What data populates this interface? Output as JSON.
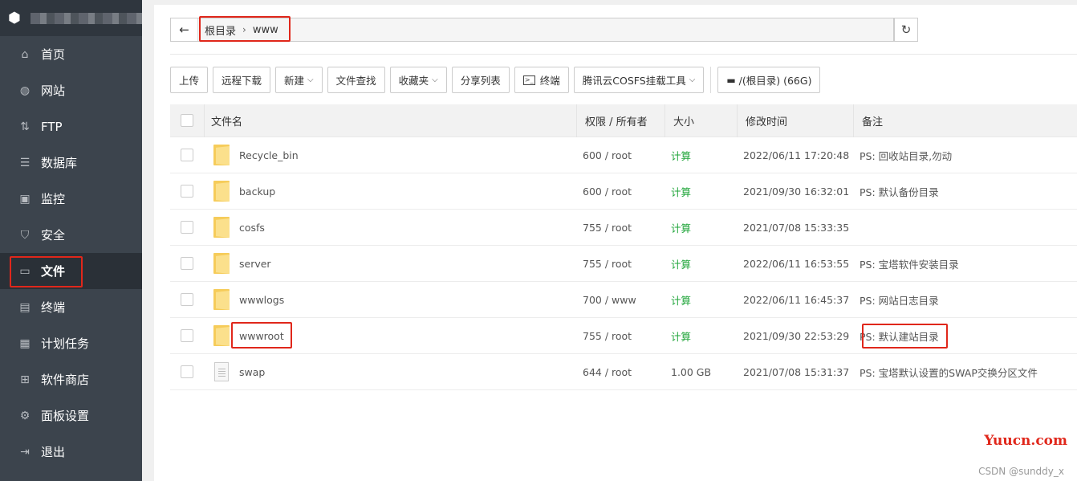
{
  "sidebar": {
    "items": [
      {
        "label": "首页",
        "icon": "home-icon"
      },
      {
        "label": "网站",
        "icon": "globe-icon"
      },
      {
        "label": "FTP",
        "icon": "ftp-icon"
      },
      {
        "label": "数据库",
        "icon": "database-icon"
      },
      {
        "label": "监控",
        "icon": "monitor-icon"
      },
      {
        "label": "安全",
        "icon": "shield-icon"
      },
      {
        "label": "文件",
        "icon": "folder-icon"
      },
      {
        "label": "终端",
        "icon": "terminal-icon"
      },
      {
        "label": "计划任务",
        "icon": "calendar-icon"
      },
      {
        "label": "软件商店",
        "icon": "apps-icon"
      },
      {
        "label": "面板设置",
        "icon": "gear-icon"
      },
      {
        "label": "退出",
        "icon": "logout-icon"
      }
    ],
    "active": "文件"
  },
  "path": {
    "root": "根目录",
    "current": "www"
  },
  "toolbar": {
    "upload": "上传",
    "remote_download": "远程下载",
    "new": "新建",
    "search": "文件查找",
    "favorites": "收藏夹",
    "share_list": "分享列表",
    "terminal": "终端",
    "cosfs": "腾讯云COSFS挂载工具",
    "disk": "/(根目录) (66G)"
  },
  "table": {
    "headers": {
      "name": "文件名",
      "perm": "权限 / 所有者",
      "size": "大小",
      "time": "修改时间",
      "note": "备注"
    },
    "rows": [
      {
        "name": "Recycle_bin",
        "type": "folder",
        "perm": "600 / root",
        "size": "计算",
        "time": "2022/06/11 17:20:48",
        "note": "PS: 回收站目录,勿动"
      },
      {
        "name": "backup",
        "type": "folder",
        "perm": "600 / root",
        "size": "计算",
        "time": "2021/09/30 16:32:01",
        "note": "PS: 默认备份目录"
      },
      {
        "name": "cosfs",
        "type": "folder",
        "perm": "755 / root",
        "size": "计算",
        "time": "2021/07/08 15:33:35",
        "note": ""
      },
      {
        "name": "server",
        "type": "folder",
        "perm": "755 / root",
        "size": "计算",
        "time": "2022/06/11 16:53:55",
        "note": "PS: 宝塔软件安装目录"
      },
      {
        "name": "wwwlogs",
        "type": "folder",
        "perm": "700 / www",
        "size": "计算",
        "time": "2022/06/11 16:45:37",
        "note": "PS: 网站日志目录"
      },
      {
        "name": "wwwroot",
        "type": "folder",
        "perm": "755 / root",
        "size": "计算",
        "time": "2021/09/30 22:53:29",
        "note": "PS: 默认建站目录"
      },
      {
        "name": "swap",
        "type": "file",
        "perm": "644 / root",
        "size": "1.00 GB",
        "time": "2021/07/08 15:31:37",
        "note": "PS: 宝塔默认设置的SWAP交换分区文件"
      }
    ]
  },
  "watermarks": {
    "site": "Yuucn.com",
    "author": "CSDN @sunddy_x"
  },
  "colors": {
    "sidebar_bg": "#3c444d",
    "accent_green": "#20a53a",
    "highlight_red": "#e0271b"
  }
}
